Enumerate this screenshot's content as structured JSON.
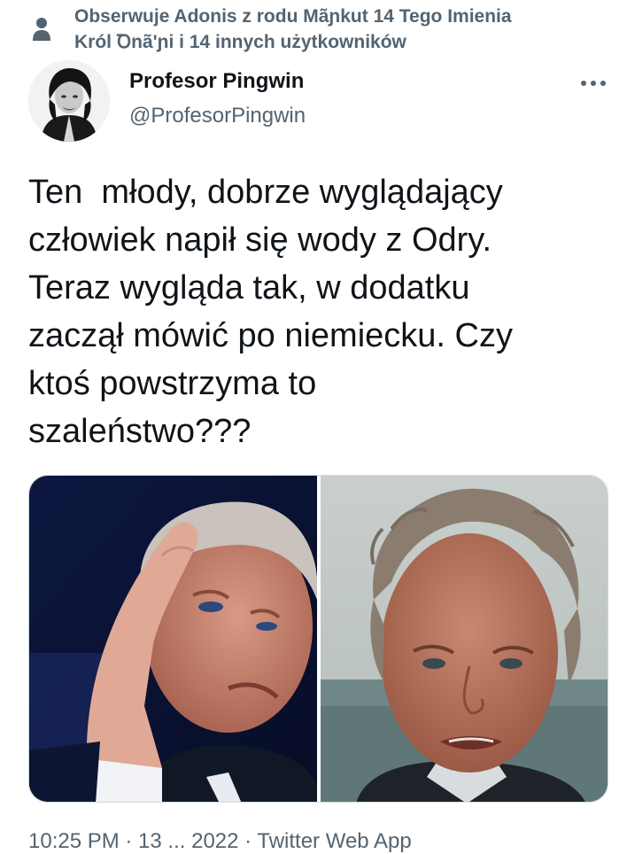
{
  "social_context": {
    "line1": "Obserwuje Adonis z rodu Mãɲkut 14 Tego Imienia",
    "line2": "Król Ꝺnã'ɲi i 14 innych użytkowników",
    "icon": "person-icon"
  },
  "author": {
    "display_name": "Profesor Pingwin",
    "handle": "@ProfesorPingwin",
    "avatar_icon": "avatar"
  },
  "more_icon": "more-dots-icon",
  "tweet": {
    "lines": [
      "Ten  młody, dobrze wyglądający",
      "człowiek napił się wody z Odry.",
      "Teraz wygląda tak, w dodatku",
      "zaczął mówić po niemiecku. Czy",
      "ktoś powstrzyma to",
      "szaleństwo???"
    ]
  },
  "media": {
    "count": 2
  },
  "timestamp": "10:25 PM · 13 ... 2022 · Twitter Web App"
}
